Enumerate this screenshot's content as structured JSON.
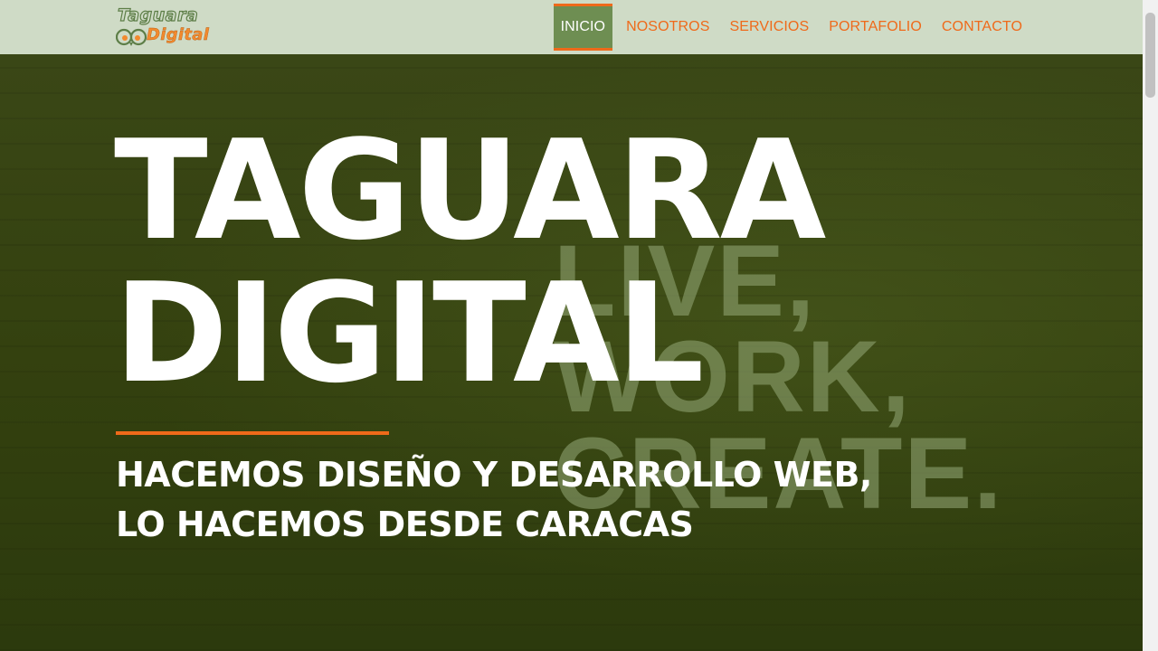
{
  "logo": {
    "line1": "Taguara",
    "line2": "Digital",
    "icon": "owl-eyes-icon"
  },
  "nav": {
    "items": [
      {
        "label": "INICIO",
        "active": true
      },
      {
        "label": "NOSOTROS",
        "active": false
      },
      {
        "label": "SERVICIOS",
        "active": false
      },
      {
        "label": "PORTAFOLIO",
        "active": false
      },
      {
        "label": "CONTACTO",
        "active": false
      }
    ]
  },
  "hero": {
    "title_line1": "TAGUARA",
    "title_line2": "DIGITAL",
    "subtitle_line1": "HACEMOS DISEÑO Y DESARROLLO WEB,",
    "subtitle_line2": "LO HACEMOS DESDE CARACAS",
    "background_text": [
      "LIVE,",
      "WORK,",
      "CREATE."
    ]
  },
  "colors": {
    "accent": "#ef6a1a",
    "nav_bg": "#cfdbc6",
    "nav_active_bg": "#6e8e52",
    "hero_bg": "#34410f",
    "text_on_hero": "#ffffff"
  }
}
